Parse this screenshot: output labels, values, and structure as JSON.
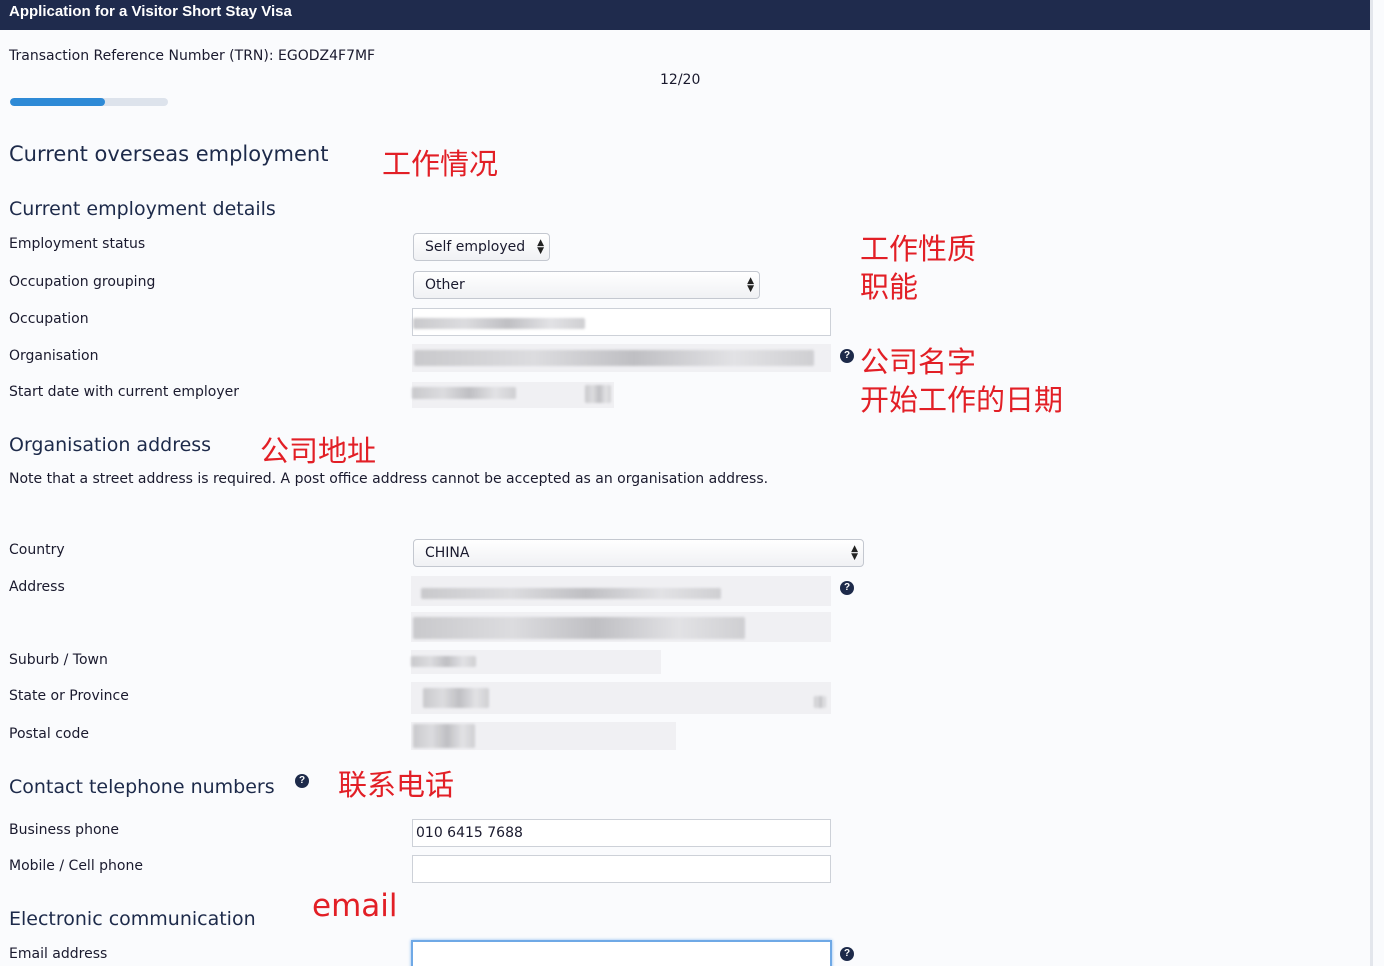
{
  "header": {
    "title": "Application for a Visitor Short Stay Visa"
  },
  "trn": "Transaction Reference Number (TRN): EGODZ4F7MF",
  "page_count": "12/20",
  "progress": {
    "value": 12,
    "total": 20
  },
  "colors": {
    "header_bg": "#1f2b4d",
    "progress": "#2e8ad6",
    "annotation": "#e21f26"
  },
  "sections": {
    "employment": {
      "title": "Current overseas employment",
      "annotation": "工作情况",
      "subtitle": "Current employment details"
    },
    "org_address": {
      "title": "Organisation address",
      "annotation": "公司地址",
      "note": "Note that a street address is required. A post office address cannot be accepted as an organisation address."
    },
    "contact": {
      "title": "Contact telephone numbers",
      "annotation": "联系电话"
    },
    "electronic": {
      "title": "Electronic communication",
      "annotation": "email"
    }
  },
  "annotations": {
    "work_nature": "工作性质",
    "function": "职能",
    "company_name": "公司名字",
    "start_date": "开始工作的日期"
  },
  "fields": {
    "employment_status": {
      "label": "Employment status",
      "value": "Self employed"
    },
    "occupation_grouping": {
      "label": "Occupation grouping",
      "value": "Other"
    },
    "occupation": {
      "label": "Occupation"
    },
    "organisation": {
      "label": "Organisation"
    },
    "start_date": {
      "label": "Start date with current employer"
    },
    "country": {
      "label": "Country",
      "value": "CHINA"
    },
    "address": {
      "label": "Address"
    },
    "suburb": {
      "label": "Suburb / Town"
    },
    "state": {
      "label": "State or Province"
    },
    "postal_code": {
      "label": "Postal code"
    },
    "business_phone": {
      "label": "Business phone",
      "value": "010 6415 7688"
    },
    "mobile_phone": {
      "label": "Mobile / Cell phone",
      "value": ""
    },
    "email": {
      "label": "Email address",
      "value": ""
    }
  },
  "icons": {
    "help": "?"
  }
}
